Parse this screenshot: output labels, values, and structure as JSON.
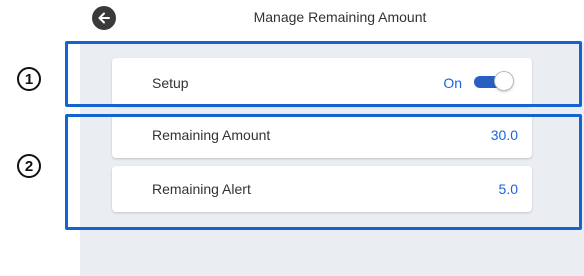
{
  "header": {
    "title": "Manage Remaining Amount",
    "back_icon": "arrow-left-icon"
  },
  "settings": {
    "setup": {
      "label": "Setup",
      "state_label": "On",
      "toggle_on": true
    },
    "remaining_amount": {
      "label": "Remaining Amount",
      "value": "30.0"
    },
    "remaining_alert": {
      "label": "Remaining Alert",
      "value": "5.0"
    }
  },
  "callouts": [
    {
      "number": "1"
    },
    {
      "number": "2"
    }
  ],
  "colors": {
    "accent": "#1b64d8",
    "callout_border": "#1463d3",
    "panel_background": "#eaedf2",
    "toggle_track": "#2a5fc2"
  }
}
